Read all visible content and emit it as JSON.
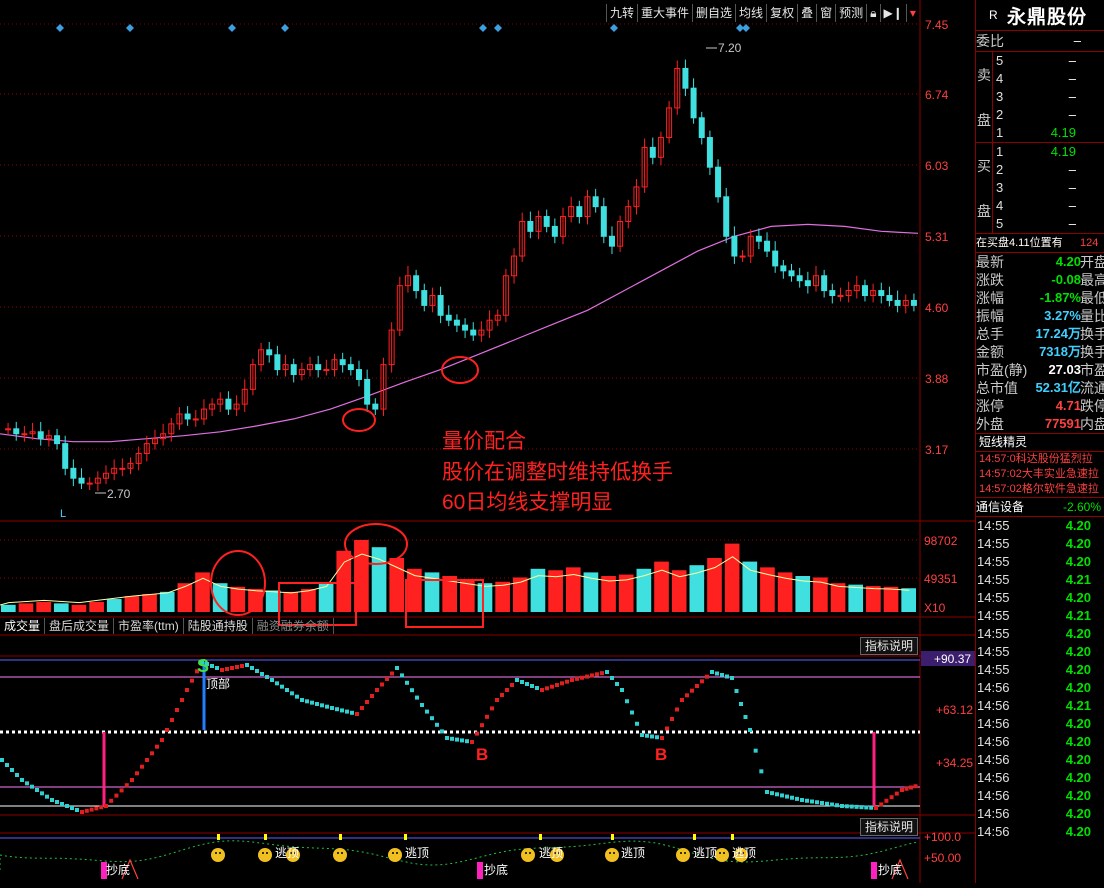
{
  "toolbar": {
    "items": [
      "九转",
      "重大事件",
      "删自选",
      "均线",
      "复权",
      "叠",
      "窗",
      "预测"
    ],
    "icons": [
      "lock-icon",
      "arrow-right-icon",
      "triangle-down-icon"
    ]
  },
  "price_axis": [
    "7.45",
    "6.74",
    "6.03",
    "5.31",
    "4.60",
    "3.88",
    "3.17"
  ],
  "annotations": {
    "high_label": "7.20",
    "low_label": "2.70",
    "l_marker": "L",
    "text_lines": [
      "量价配合",
      "股价在调整时维持低换手",
      "60日均线支撑明显"
    ]
  },
  "volume_axis": [
    "98702",
    "49351",
    "X10"
  ],
  "tabs": [
    "成交量",
    "盘后成交量",
    "市盈率(ttm)",
    "陆股通持股",
    "融资融券余额"
  ],
  "indicator_button": "指标说明",
  "indicator1": {
    "axis": [
      "+90.37",
      "+63.12",
      "+34.25"
    ],
    "labels": {
      "s": "S",
      "top": "顶部",
      "b1": "B",
      "b2": "B"
    }
  },
  "indicator2": {
    "axis": [
      "+100.0",
      "+50.00"
    ],
    "labels": {
      "bottom": "抄底",
      "escape": "逃顶"
    }
  },
  "quote": {
    "r": "R",
    "name": "永鼎股份",
    "weibi_label": "委比",
    "weibi_value": "–",
    "sell_label": [
      "卖",
      "盘"
    ],
    "buy_label": [
      "买",
      "盘"
    ],
    "sell_levels": [
      {
        "lv": "5",
        "price": "–"
      },
      {
        "lv": "4",
        "price": "–"
      },
      {
        "lv": "3",
        "price": "–"
      },
      {
        "lv": "2",
        "price": "–"
      },
      {
        "lv": "1",
        "price": "4.19"
      }
    ],
    "buy_levels": [
      {
        "lv": "1",
        "price": "4.19"
      },
      {
        "lv": "2",
        "price": "–"
      },
      {
        "lv": "3",
        "price": "–"
      },
      {
        "lv": "4",
        "price": "–"
      },
      {
        "lv": "5",
        "price": "–"
      }
    ],
    "queue": "在买盘4.11位置有",
    "queue_tail": "124",
    "stats": [
      {
        "label": "最新",
        "value": "4.20",
        "cls": "green",
        "right": "开盘"
      },
      {
        "label": "涨跌",
        "value": "-0.08",
        "cls": "green",
        "right": "最高"
      },
      {
        "label": "涨幅",
        "value": "-1.87%",
        "cls": "green",
        "right": "最低"
      },
      {
        "label": "振幅",
        "value": "3.27%",
        "cls": "cyan",
        "right": "量比"
      },
      {
        "label": "总手",
        "value": "17.24万",
        "cls": "cyan",
        "right": "换手"
      },
      {
        "label": "金额",
        "value": "7318万",
        "cls": "cyan",
        "right": "换手"
      },
      {
        "label": "市盈(静)",
        "value": "27.03",
        "cls": "white",
        "right": "市盈"
      },
      {
        "label": "总市值",
        "value": "52.31亿",
        "cls": "cyan",
        "right": "流通"
      },
      {
        "label": "涨停",
        "value": "4.71",
        "cls": "red",
        "right": "跌停"
      },
      {
        "label": "外盘",
        "value": "77591",
        "cls": "red",
        "right": "内盘"
      }
    ],
    "news_title": "短线精灵",
    "news": [
      "14:57:0科达股份猛烈拉",
      "14:57:02大丰实业急速拉",
      "14:57:02格尔软件急速拉"
    ],
    "sector": "通信设备",
    "sector_change": "-2.60%",
    "ticks": [
      {
        "t": "14:55",
        "p": "4.20"
      },
      {
        "t": "14:55",
        "p": "4.20"
      },
      {
        "t": "14:55",
        "p": "4.20"
      },
      {
        "t": "14:55",
        "p": "4.21"
      },
      {
        "t": "14:55",
        "p": "4.20"
      },
      {
        "t": "14:55",
        "p": "4.21"
      },
      {
        "t": "14:55",
        "p": "4.20"
      },
      {
        "t": "14:55",
        "p": "4.20"
      },
      {
        "t": "14:55",
        "p": "4.20"
      },
      {
        "t": "14:56",
        "p": "4.20"
      },
      {
        "t": "14:56",
        "p": "4.21"
      },
      {
        "t": "14:56",
        "p": "4.20"
      },
      {
        "t": "14:56",
        "p": "4.20"
      },
      {
        "t": "14:56",
        "p": "4.20"
      },
      {
        "t": "14:56",
        "p": "4.20"
      },
      {
        "t": "14:56",
        "p": "4.20"
      },
      {
        "t": "14:56",
        "p": "4.20"
      },
      {
        "t": "14:56",
        "p": "4.20"
      }
    ]
  },
  "colors": {
    "up": "#ff2020",
    "down": "#40e0e0",
    "ma": "#e070e0",
    "grid": "#8b0000",
    "annotation": "#ff2020"
  },
  "chart_data": {
    "type": "candlestick",
    "price_range": [
      2.7,
      7.45
    ],
    "low": 2.7,
    "high": 7.2,
    "series": [
      {
        "name": "price_close_approx",
        "values": [
          3.35,
          3.3,
          3.3,
          3.32,
          3.25,
          3.28,
          3.2,
          2.95,
          2.85,
          2.8,
          2.8,
          2.85,
          2.9,
          2.95,
          2.95,
          3.0,
          3.1,
          3.2,
          3.25,
          3.3,
          3.4,
          3.5,
          3.45,
          3.45,
          3.55,
          3.6,
          3.65,
          3.55,
          3.6,
          3.75,
          4.0,
          4.15,
          4.1,
          3.95,
          4.0,
          3.9,
          3.95,
          4.0,
          3.95,
          3.95,
          4.05,
          4.0,
          3.95,
          3.85,
          3.6,
          3.55,
          4.0,
          4.35,
          4.8,
          4.9,
          4.75,
          4.6,
          4.7,
          4.5,
          4.45,
          4.4,
          4.35,
          4.3,
          4.35,
          4.45,
          4.5,
          4.9,
          5.1,
          5.45,
          5.35,
          5.5,
          5.4,
          5.3,
          5.5,
          5.6,
          5.5,
          5.7,
          5.6,
          5.3,
          5.2,
          5.45,
          5.6,
          5.8,
          6.2,
          6.1,
          6.3,
          6.6,
          7.0,
          6.8,
          6.5,
          6.3,
          6.0,
          5.7,
          5.3,
          5.1,
          5.1,
          5.3,
          5.25,
          5.15,
          5.0,
          4.95,
          4.9,
          4.85,
          4.8,
          4.9,
          4.75,
          4.7,
          4.7,
          4.75,
          4.8,
          4.7,
          4.75,
          4.7,
          4.65,
          4.6,
          4.65,
          4.6
        ]
      },
      {
        "name": "ma60_approx",
        "values": [
          3.3,
          3.25,
          3.22,
          3.22,
          3.25,
          3.28,
          3.32,
          3.38,
          3.45,
          3.55,
          3.68,
          3.82,
          3.95,
          4.1,
          4.25,
          4.4,
          4.55,
          4.75,
          4.95,
          5.15,
          5.3,
          5.4,
          5.42,
          5.4,
          5.35,
          5.33
        ]
      },
      {
        "name": "volume_approx",
        "values": [
          10,
          12,
          14,
          12,
          10,
          14,
          18,
          22,
          25,
          28,
          40,
          55,
          40,
          35,
          32,
          30,
          28,
          32,
          40,
          85,
          100,
          90,
          75,
          60,
          55,
          50,
          45,
          40,
          42,
          48,
          60,
          58,
          62,
          55,
          50,
          52,
          60,
          70,
          58,
          65,
          75,
          95,
          70,
          62,
          55,
          50,
          48,
          40,
          38,
          36,
          35,
          33
        ]
      }
    ]
  }
}
